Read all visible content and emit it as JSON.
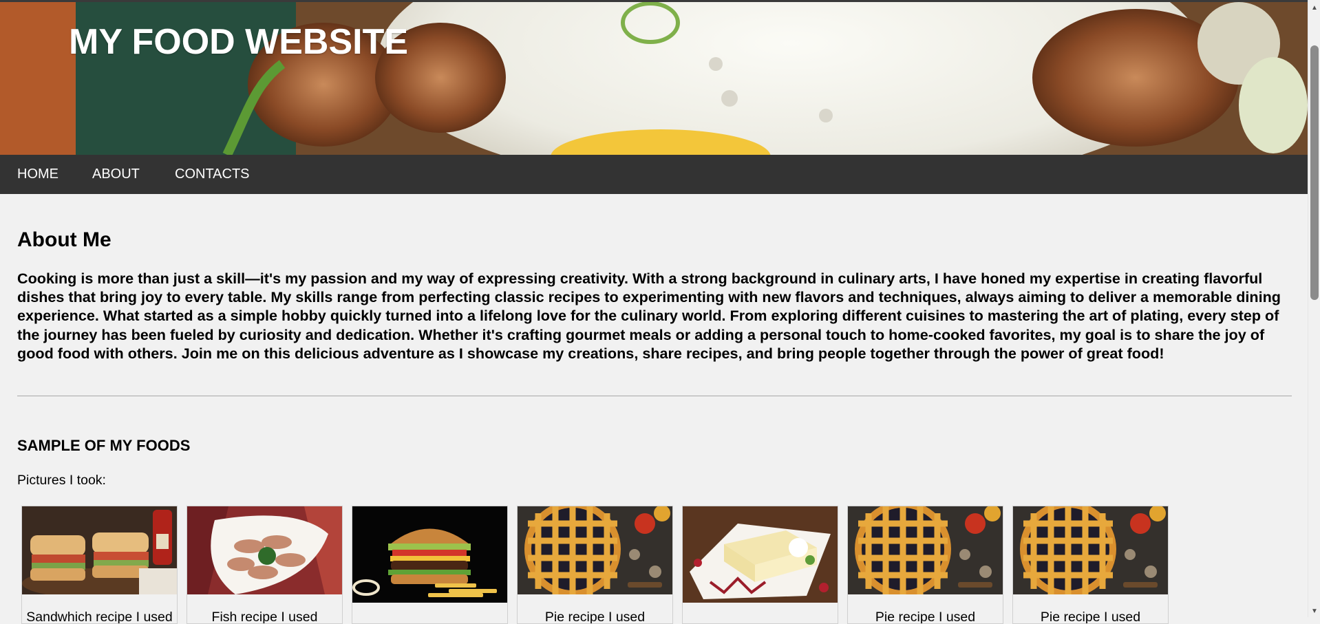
{
  "site": {
    "title": "MY FOOD WEBSITE"
  },
  "nav": {
    "items": [
      {
        "label": "HOME"
      },
      {
        "label": "ABOUT"
      },
      {
        "label": "CONTACTS"
      }
    ]
  },
  "about": {
    "title": "About Me",
    "text": "Cooking is more than just a skill—it's my passion and my way of expressing creativity. With a strong background in culinary arts, I have honed my expertise in creating flavorful dishes that bring joy to every table. My skills range from perfecting classic recipes to experimenting with new flavors and techniques, always aiming to deliver a memorable dining experience. What started as a simple hobby quickly turned into a lifelong love for the culinary world. From exploring different cuisines to mastering the art of plating, every step of the journey has been fueled by curiosity and dedication. Whether it's crafting gourmet meals or adding a personal touch to home-cooked favorites, my goal is to share the joy of good food with others. Join me on this delicious adventure as I showcase my creations, share recipes, and bring people together through the power of great food!"
  },
  "samples": {
    "title": "SAMPLE OF MY FOODS",
    "pictures_label": "Pictures I took:",
    "cards": [
      {
        "image": "sandwich-photo",
        "caption": "Sandwhich recipe I used"
      },
      {
        "image": "fish-photo",
        "caption": "Fish recipe I used"
      },
      {
        "image": "burger-photo",
        "caption": ""
      },
      {
        "image": "pie-photo",
        "caption": "Pie recipe I used"
      },
      {
        "image": "cheesecake-photo",
        "caption": ""
      },
      {
        "image": "pie-photo",
        "caption": "Pie recipe I used"
      },
      {
        "image": "pie-photo",
        "caption": "Pie recipe I used"
      }
    ]
  },
  "colors": {
    "nav_bg": "#333333",
    "page_bg": "#f1f1f1",
    "title_text": "#ffffff"
  }
}
